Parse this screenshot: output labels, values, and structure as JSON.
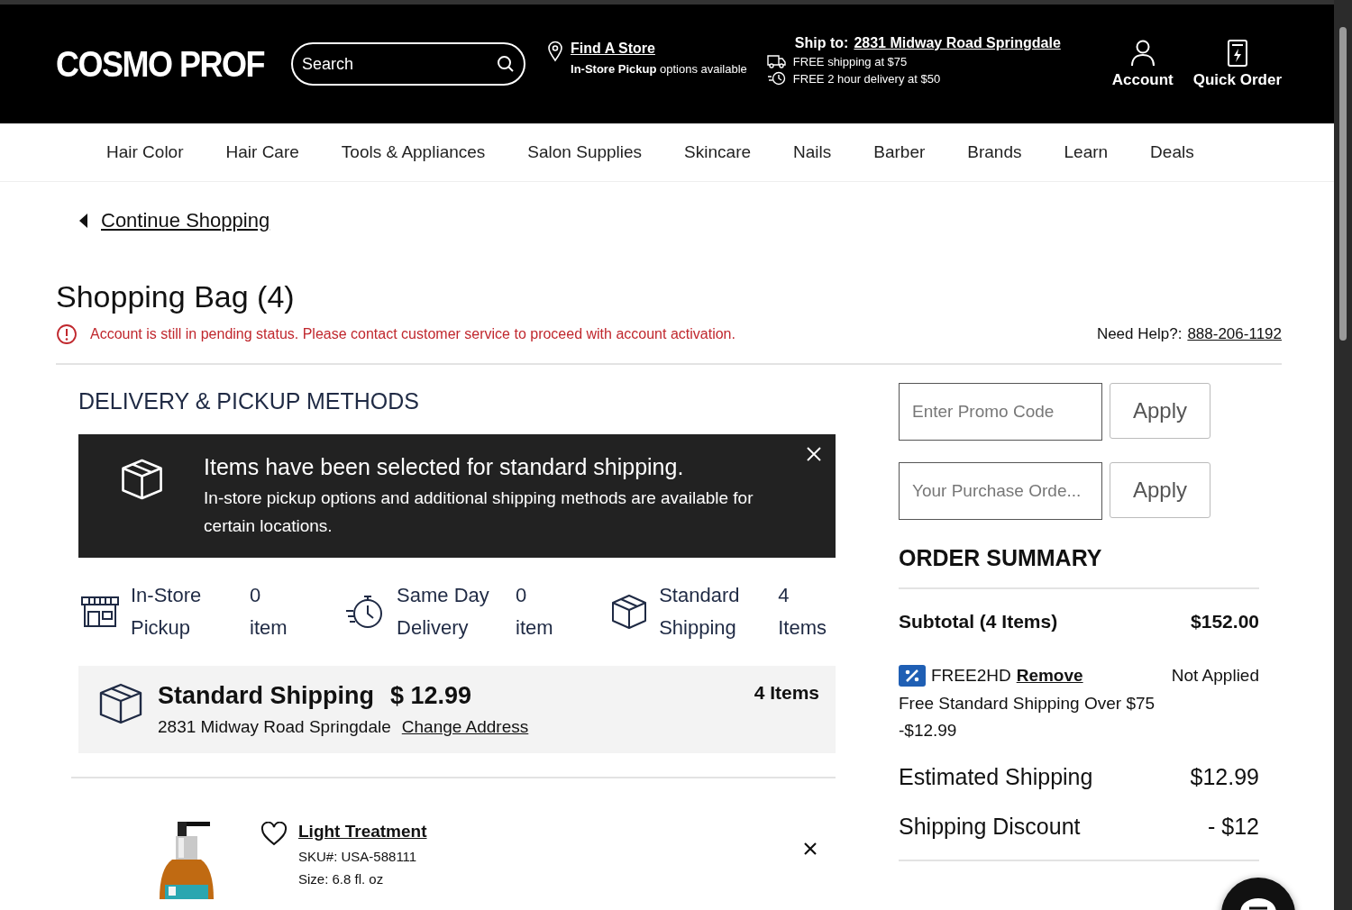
{
  "header": {
    "logo": "COSMO PROF",
    "search": {
      "placeholder": "Search"
    },
    "find_store": {
      "link": "Find A Store",
      "note": "**In-Store Pickup** options available"
    },
    "ship_to": {
      "label": "Ship to:",
      "address": "2831 Midway Road Springdale",
      "lines": [
        "FREE shipping at $75",
        "FREE 2 hour delivery at $50"
      ]
    },
    "actions": [
      {
        "kind": "account",
        "label": "Account"
      },
      {
        "kind": "quick_order",
        "label": "Quick Order"
      }
    ]
  },
  "nav": [
    "Hair Color",
    "Hair Care",
    "Tools & Appliances",
    "Salon Supplies",
    "Skincare",
    "Nails",
    "Barber",
    "Brands",
    "Learn",
    "Deals"
  ],
  "continue_shopping": "Continue Shopping",
  "title": "Shopping Bag (4)",
  "alert": "Account is still in pending status. Please contact customer service to proceed with account activation.",
  "help": {
    "label": "Need Help?:",
    "phone": "888-206-1192"
  },
  "delivery": {
    "heading": "DELIVERY & PICKUP METHODS",
    "notice": {
      "title": "Items have been selected for standard shipping.",
      "body": "In-store pickup options and additional shipping methods are available for certain locations."
    },
    "methods": [
      {
        "kind": "pickup",
        "label": "In-Store Pickup",
        "count": "0",
        "unit": "item"
      },
      {
        "kind": "same_day",
        "label": "Same Day Delivery",
        "count": "0",
        "unit": "item"
      },
      {
        "kind": "standard",
        "label": "Standard Shipping",
        "count": "4",
        "unit": "Items"
      }
    ],
    "shipment": {
      "title": "Standard Shipping",
      "price": "$ 12.99",
      "address": "2831 Midway Road Springdale",
      "change_link": "Change Address",
      "count": "4 Items"
    }
  },
  "item": {
    "name": "Light Treatment",
    "sku": "SKU#: USA-588111",
    "size": "Size: 6.8 fl. oz"
  },
  "summary": {
    "promo": {
      "placeholder": "Enter Promo Code",
      "button": "Apply"
    },
    "purchase_order": {
      "placeholder": "Your Purchase Orde...",
      "button": "Apply"
    },
    "heading": "ORDER SUMMARY",
    "subtotal": {
      "label": "Subtotal (4 Items)",
      "value": "$152.00"
    },
    "coupon": {
      "code": "FREE2HD",
      "remove": "Remove",
      "status": "Not Applied",
      "description": "Free Standard Shipping Over $75",
      "amount": "-$12.99"
    },
    "rows": [
      {
        "label": "Estimated Shipping",
        "value": "$12.99"
      },
      {
        "label": "Shipping Discount",
        "value": "- $12"
      }
    ]
  }
}
